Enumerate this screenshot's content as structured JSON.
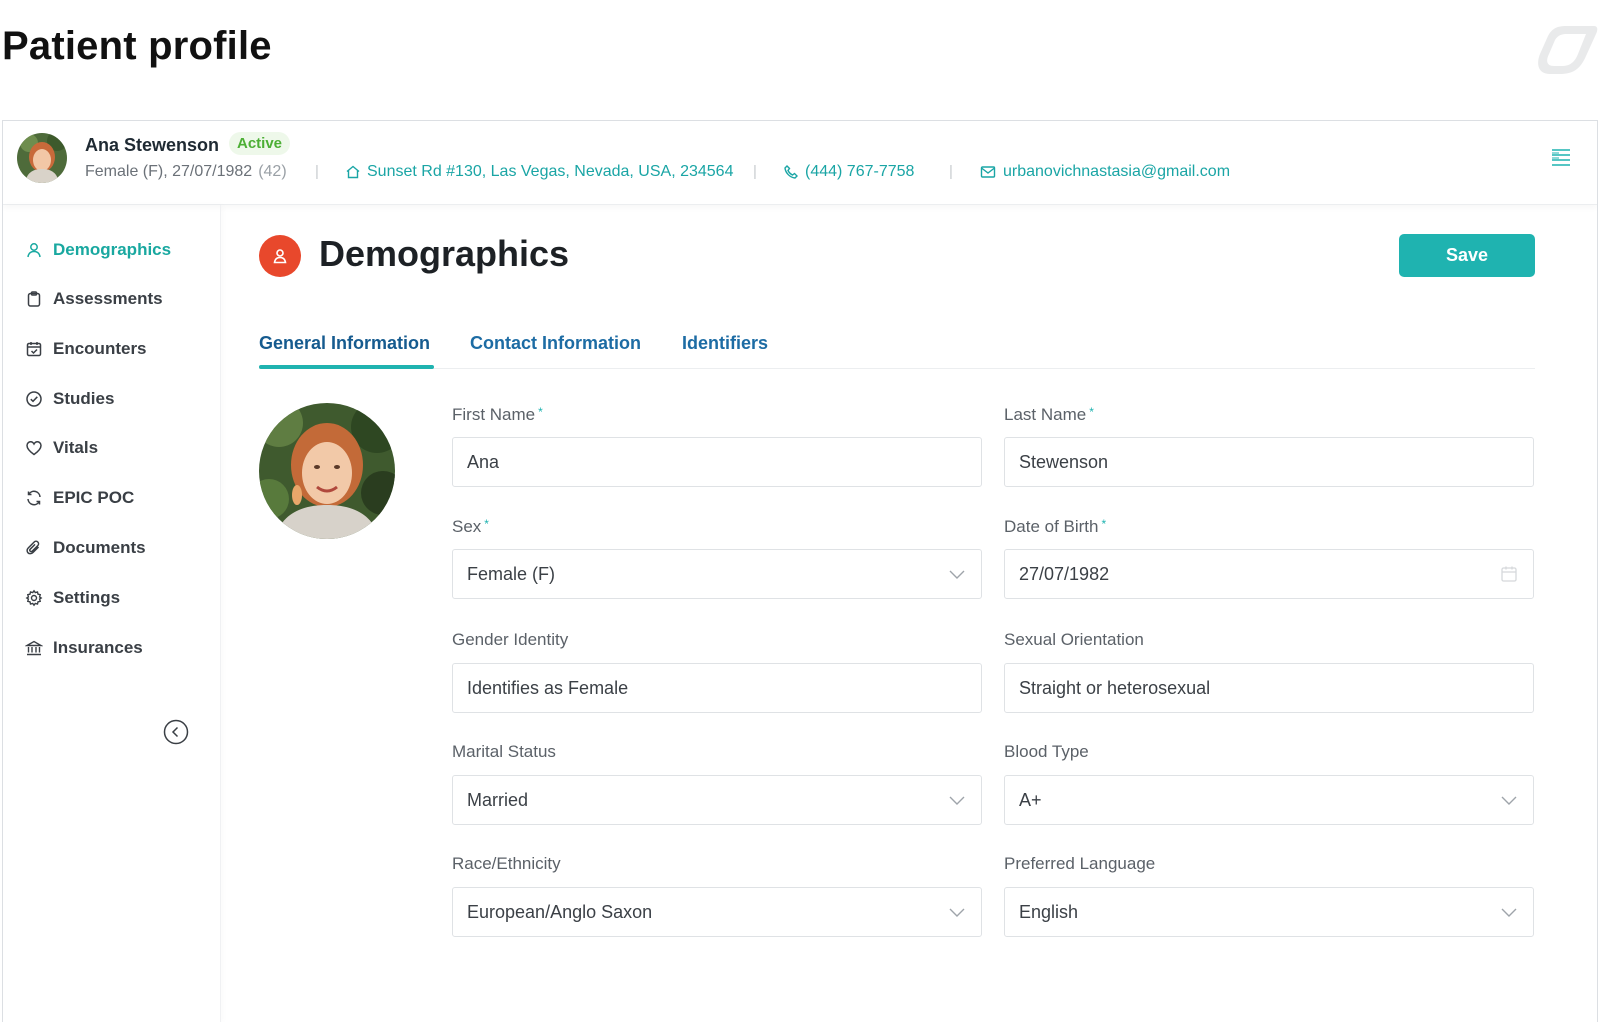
{
  "page": {
    "title": "Patient profile"
  },
  "patient": {
    "name": "Ana Stewenson",
    "status": "Active",
    "sex_dob": "Female (F), 27/07/1982",
    "age": "(42)",
    "address": "Sunset Rd #130, Las Vegas, Nevada, USA, 234564",
    "phone": "(444) 767-7758",
    "email": "urbanovichnastasia@gmail.com",
    "separator": "|"
  },
  "sidebar": {
    "items": [
      {
        "label": "Demographics",
        "icon": "user-icon"
      },
      {
        "label": "Assessments",
        "icon": "clipboard-icon"
      },
      {
        "label": "Encounters",
        "icon": "calendar-check-icon"
      },
      {
        "label": "Studies",
        "icon": "check-circle-icon"
      },
      {
        "label": "Vitals",
        "icon": "heart-icon"
      },
      {
        "label": "EPIC POC",
        "icon": "refresh-icon"
      },
      {
        "label": "Documents",
        "icon": "paperclip-icon"
      },
      {
        "label": "Settings",
        "icon": "gear-icon"
      },
      {
        "label": "Insurances",
        "icon": "bank-icon"
      }
    ],
    "active_index": 0
  },
  "section": {
    "title": "Demographics",
    "save_label": "Save"
  },
  "tabs": [
    {
      "label": "General Information"
    },
    {
      "label": "Contact Information"
    },
    {
      "label": "Identifiers"
    }
  ],
  "form": {
    "first_name": {
      "label": "First Name",
      "value": "Ana",
      "required_mark": "*"
    },
    "last_name": {
      "label": "Last Name",
      "value": "Stewenson",
      "required_mark": "*"
    },
    "sex": {
      "label": "Sex",
      "value": "Female (F)",
      "required_mark": "*"
    },
    "dob": {
      "label": "Date of Birth",
      "value": "27/07/1982",
      "required_mark": "*"
    },
    "gender_identity": {
      "label": "Gender Identity",
      "value": "Identifies as Female"
    },
    "sexual_orientation": {
      "label": "Sexual Orientation",
      "value": "Straight or heterosexual"
    },
    "marital_status": {
      "label": "Marital Status",
      "value": "Married"
    },
    "blood_type": {
      "label": "Blood Type",
      "value": "A+"
    },
    "race": {
      "label": "Race/Ethnicity",
      "value": "European/Anglo Saxon"
    },
    "language": {
      "label": "Preferred Language",
      "value": "English"
    }
  },
  "colors": {
    "accent": "#1fb3b0",
    "active_green": "#4caf35",
    "section_icon": "#e8482c",
    "tab_blue": "#1d6ca4"
  }
}
